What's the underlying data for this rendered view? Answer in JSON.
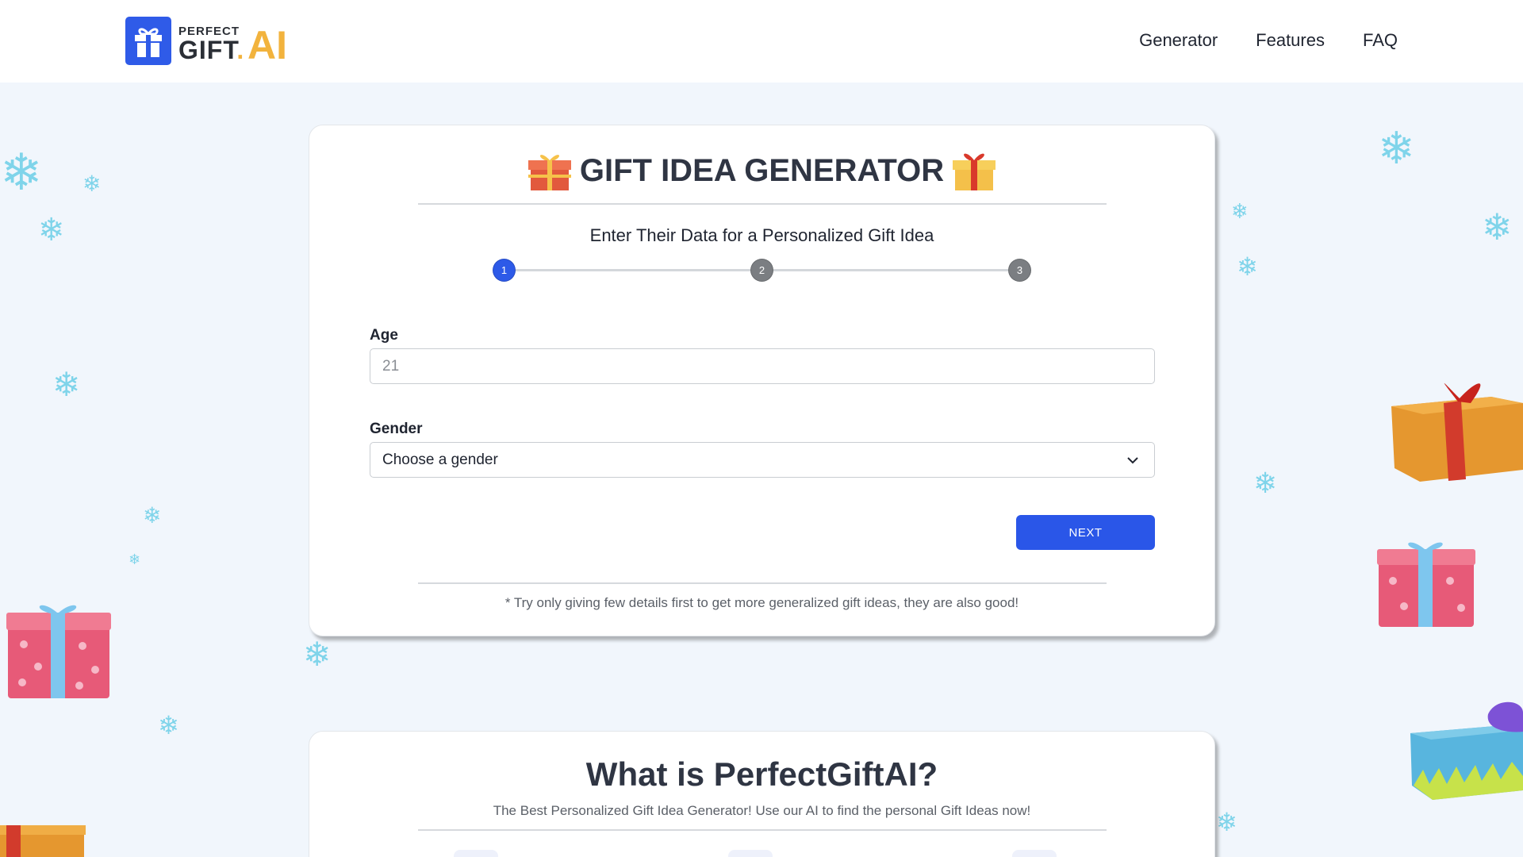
{
  "header": {
    "logo_small": "PERFECT",
    "logo_main": "GIFT",
    "logo_dot": ".",
    "logo_ai": "AI",
    "nav": [
      "Generator",
      "Features",
      "FAQ"
    ]
  },
  "generator": {
    "title": "GIFT IDEA GENERATOR",
    "subtitle": "Enter Their Data for a Personalized Gift Idea",
    "steps": [
      "1",
      "2",
      "3"
    ],
    "active_step": 1,
    "age_label": "Age",
    "age_placeholder": "21",
    "gender_label": "Gender",
    "gender_selected": "Choose a gender",
    "next_label": "NEXT",
    "hint": "* Try only giving few details first to get more generalized gift ideas, they are also good!"
  },
  "about": {
    "title": "What is PerfectGiftAI?",
    "subtitle": "The Best Personalized Gift Idea Generator! Use our AI to find the personal Gift Ideas now!"
  },
  "icons": [
    "gift-logo-icon",
    "gift-emoji-icon",
    "chevron-down-icon",
    "snowflake-icon",
    "gift-box-decoration"
  ],
  "colors": {
    "accent": "#2d5ae8",
    "logo_ai": "#f2b33d",
    "background": "#f1f6fc",
    "snowflake": "#7fd4ea"
  }
}
